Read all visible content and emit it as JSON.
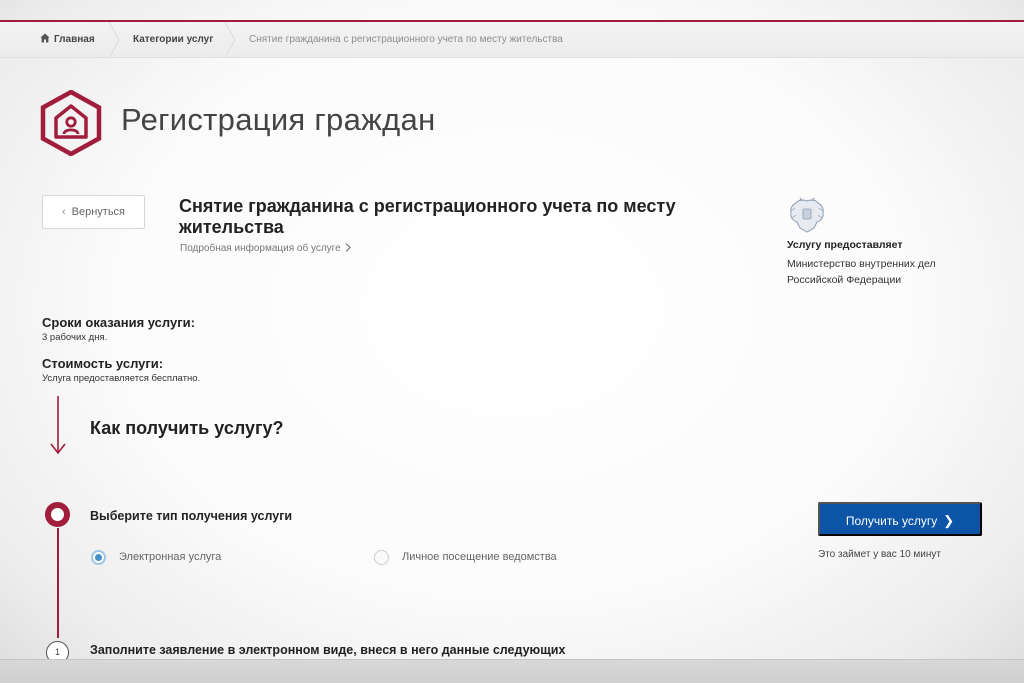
{
  "breadcrumbs": {
    "home": "Главная",
    "category": "Категории услуг",
    "current": "Снятие гражданина с регистрационного учета по месту жительства"
  },
  "header": {
    "title": "Регистрация граждан"
  },
  "service": {
    "back_label": "Вернуться",
    "title": "Снятие гражданина с регистрационного учета по месту жительства",
    "details_link": "Подробная информация об услуге",
    "provider_label": "Услугу предоставляет",
    "provider_name": "Министерство внутренних дел Российской Федерации"
  },
  "info": {
    "term_label": "Сроки оказания услуги:",
    "term_value": "3 рабочих дня.",
    "cost_label": "Стоимость услуги:",
    "cost_value": "Услуга предоставляется бесплатно."
  },
  "how": {
    "heading": "Как получить услугу?",
    "step_choose": "Выберите тип получения услуги",
    "options": [
      {
        "label": "Электронная услуга",
        "selected": true
      },
      {
        "label": "Личное посещение ведомства",
        "selected": false
      }
    ],
    "get_button": "Получить услугу",
    "time_note": "Это займет у вас 10 минут",
    "step1_number": "1",
    "step1_text": "Заполните заявление в электронном виде, внеся в него данные следующих"
  },
  "colors": {
    "accent": "#a11d3c",
    "primary_button": "#0b54a6",
    "radio_selected": "#4a90c8"
  },
  "icons": {
    "home": "home-icon",
    "logo": "registration-house-icon",
    "emblem": "russian-coat-of-arms-icon",
    "back": "chevron-left-icon",
    "details": "chevron-right-icon",
    "arrow": "arrow-down-icon"
  }
}
